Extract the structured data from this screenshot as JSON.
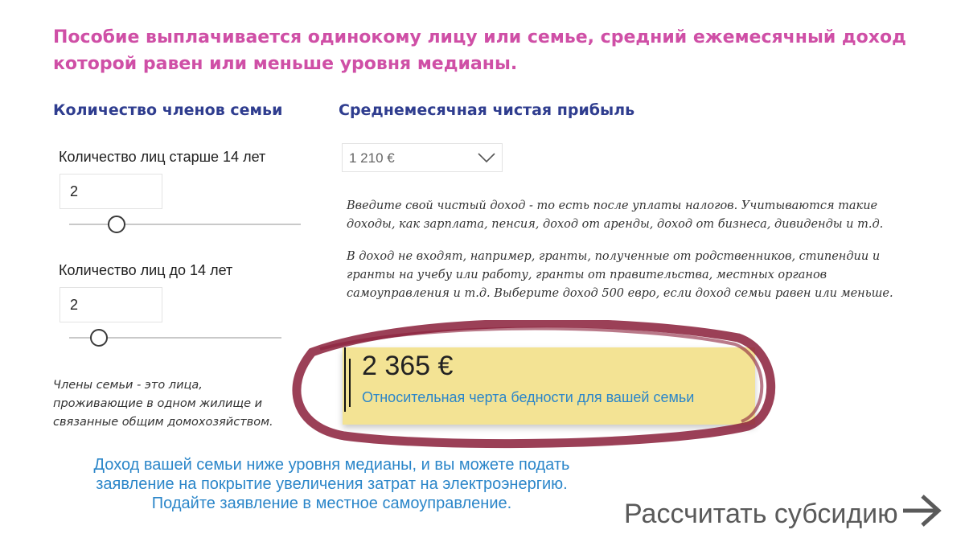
{
  "headline": "Пособие выплачивается одинокому лицу или семье, средний ежемесячный доход которой равен или меньше уровня медианы.",
  "family": {
    "title": "Количество членов семьи",
    "adults_label": "Количество лиц старше 14 лет",
    "adults_value": "2",
    "kids_label": "Количество лиц до 14 лет",
    "kids_value": "2",
    "note": "Члены семьи - это лица, проживающие в одном жилище и связанные общим домохозяйством."
  },
  "income": {
    "title": "Среднемесячная чистая прибыль",
    "selected": "1 210 €",
    "help_1": "Введите свой чистый доход - то есть после уплаты налогов. Учитываются такие доходы, как зарплата, пенсия, доход от аренды, доход от бизнеса, дивиденды и т.д.",
    "help_2": "В доход не входят, например, гранты, полученные от родственников, стипендии и гранты на учебу или работу, гранты от правительства, местных органов самоуправления и т.д. Выберите доход 500 евро, если доход семьи равен или меньше."
  },
  "result": {
    "amount": "2 365 €",
    "caption": "Относительная черта бедности для вашей семьи"
  },
  "eligibility_text": "Доход вашей семьи ниже уровня медианы, и вы можете подать заявление на покрытие увеличения затрат на электроэнергию. Подайте заявление в местное самоуправление.",
  "calc_button": {
    "label": "Рассчитать субсидию",
    "icon": "arrow-right-icon"
  },
  "colors": {
    "headline": "#cf4fa6",
    "section_title": "#2f3d8f",
    "link_blue": "#2b86c9",
    "result_bg": "#f3e394",
    "highlight_ring": "#8a1f3a"
  }
}
